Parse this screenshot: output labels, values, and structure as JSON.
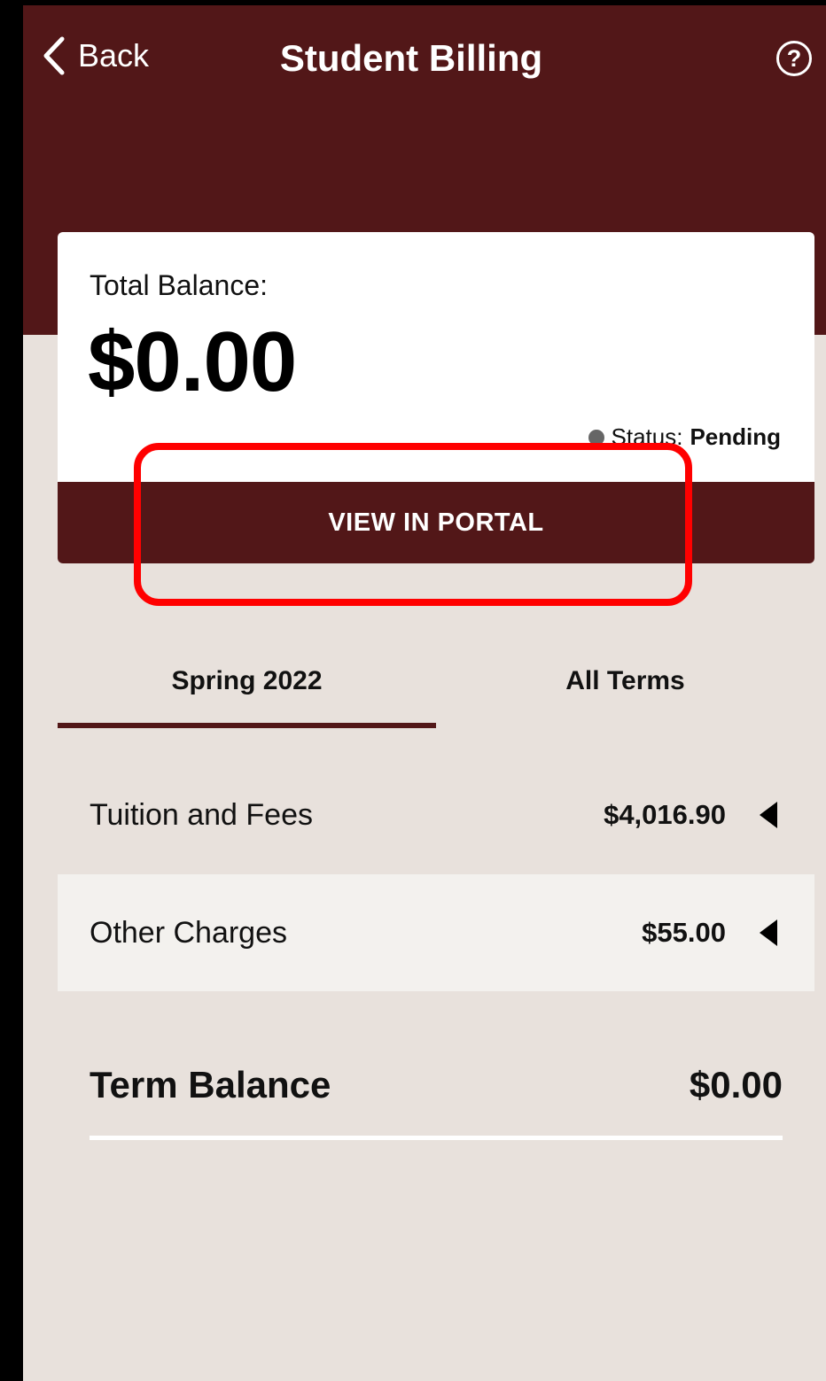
{
  "header": {
    "back_label": "Back",
    "title": "Student Billing",
    "help_icon": "?"
  },
  "balance_card": {
    "label": "Total Balance:",
    "amount": "$0.00",
    "status_label": "Status:",
    "status_value": "Pending",
    "portal_button": "VIEW IN PORTAL"
  },
  "tabs": [
    {
      "label": "Spring 2022",
      "active": true
    },
    {
      "label": "All Terms",
      "active": false
    }
  ],
  "charges": [
    {
      "name": "Tuition and Fees",
      "amount": "$4,016.90"
    },
    {
      "name": "Other Charges",
      "amount": "$55.00"
    }
  ],
  "term_balance": {
    "label": "Term Balance",
    "amount": "$0.00"
  },
  "colors": {
    "brand": "#521718",
    "background": "#e8e1dc",
    "highlight": "#ff0000"
  }
}
